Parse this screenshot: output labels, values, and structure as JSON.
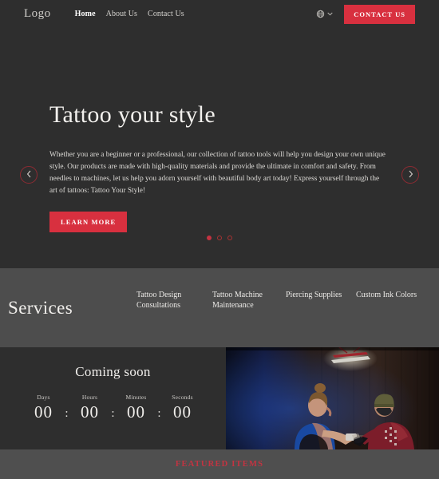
{
  "header": {
    "logo": "Logo",
    "nav": [
      {
        "label": "Home",
        "active": true
      },
      {
        "label": "About Us",
        "active": false
      },
      {
        "label": "Contact Us",
        "active": false
      }
    ],
    "lang_icon": "globe-icon",
    "chevron_icon": "chevron-down-icon",
    "cta_label": "CONTACT US"
  },
  "hero": {
    "title": "Tattoo your style",
    "description": "Whether you are a beginner or a professional, our collection of tattoo tools will help you design your own unique style. Our products are made with high-quality materials and provide the ultimate in comfort and safety. From needles to machines, let us help you adorn yourself with beautiful body art today! Express yourself through the art of tattoos: Tattoo Your Style!",
    "cta_label": "LEARN MORE",
    "prev_icon": "chevron-left-icon",
    "next_icon": "chevron-right-icon",
    "slides": 3,
    "active_slide": 1
  },
  "services": {
    "title": "Services",
    "items": [
      "Tattoo Design Consultations",
      "Tattoo Machine Maintenance",
      "Piercing Supplies",
      "Custom Ink Colors"
    ]
  },
  "coming_soon": {
    "title": "Coming soon",
    "units": [
      {
        "label": "Days",
        "value": "00"
      },
      {
        "label": "Hours",
        "value": "00"
      },
      {
        "label": "Minutes",
        "value": "00"
      },
      {
        "label": "Seconds",
        "value": "00"
      }
    ],
    "separator": ":",
    "photo_alt": "tattoo-artist-working-photo"
  },
  "featured": {
    "title": "FEATURED ITEMS"
  },
  "colors": {
    "background_dark": "#2e2e2e",
    "background_mid": "#4d4d4d",
    "background_band": "#4f4f4f",
    "accent_red": "#d8303f",
    "accent_red_dark": "#c43341",
    "text_light": "#f0eeeb"
  }
}
